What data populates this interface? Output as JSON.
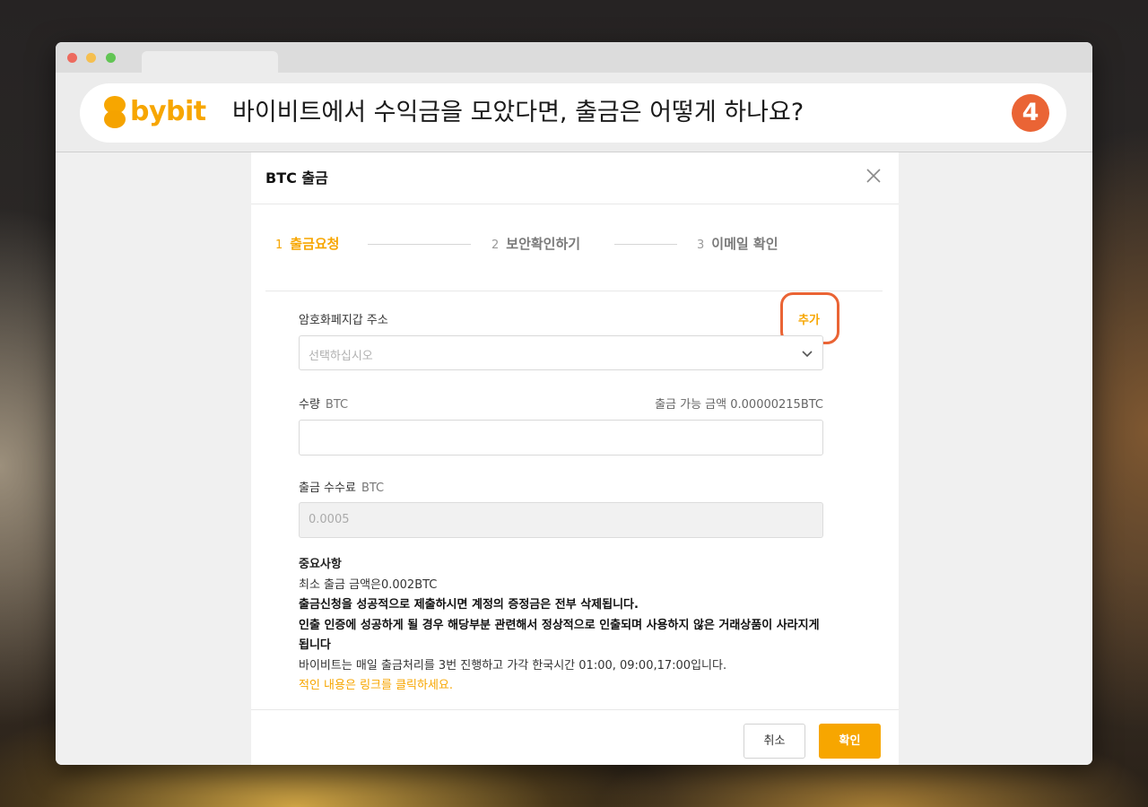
{
  "header": {
    "brand": "bybit",
    "headline": "바이비트에서 수익금을 모았다면, 출금은 어떻게 하나요?",
    "step_number": "4"
  },
  "modal": {
    "title": "BTC 출금",
    "steps": [
      {
        "num": "1",
        "label": "출금요청",
        "active": true
      },
      {
        "num": "2",
        "label": "보안확인하기",
        "active": false
      },
      {
        "num": "3",
        "label": "이메일 확인",
        "active": false
      }
    ],
    "address": {
      "label": "암호화페지갑 주소",
      "add_link": "추가",
      "placeholder": "선택하십시오"
    },
    "amount": {
      "label": "수량",
      "unit": "BTC",
      "available_label": "출금 가능 금액",
      "available_value": "0.00000215BTC",
      "value": ""
    },
    "fee": {
      "label": "출금 수수료",
      "unit": "BTC",
      "value": "0.0005"
    },
    "notes": {
      "title": "중요사항",
      "min_amount": "최소 출금 금액은0.002BTC",
      "bold_line1": "출금신청을 성공적으로 제출하시면 계정의 증정금은 전부 삭제됩니다.",
      "bold_line2": "인출 인증에 성공하게 될 경우 해당부분 관련해서 정상적으로 인출되며 사용하지 않은 거래상품이 사라지게 됩니다",
      "schedule": "바이비트는 매일 출금처리를 3번 진행하고 가각 한국시간 01:00, 09:00,17:00입니다.",
      "link": "적인 내용은 링크를 클릭하세요."
    },
    "buttons": {
      "cancel": "취소",
      "confirm": "확인"
    }
  },
  "colors": {
    "brand": "#f7a600",
    "highlight": "#ea6435"
  }
}
